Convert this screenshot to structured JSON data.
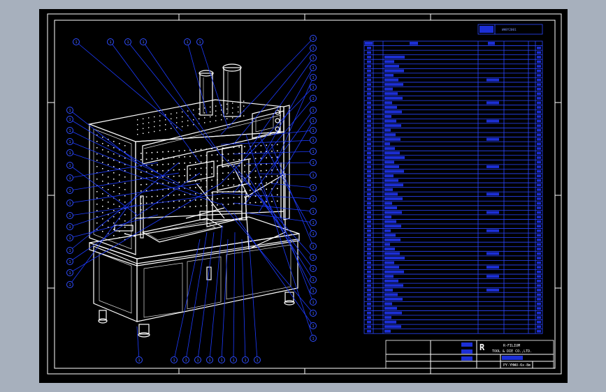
{
  "drawing": {
    "drawing_number_top": "WH8Y2001",
    "balloon_text": "1",
    "title_block": {
      "company_line1": "R-FILIUM",
      "company_line2": "TOOL & DIE CO.,LTD.",
      "logo": "R",
      "drawing_number": "PY-YHWU-6x-8m"
    }
  }
}
